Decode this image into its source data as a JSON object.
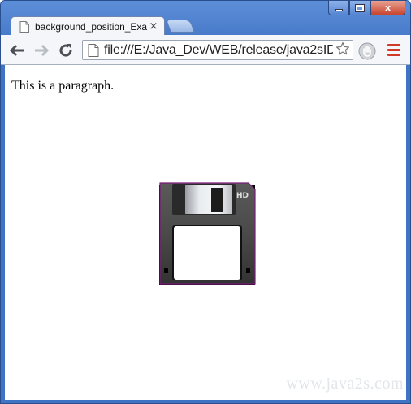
{
  "window": {
    "controls": {
      "minimize_label": "",
      "maximize_label": "",
      "close_label": "x"
    }
  },
  "tab": {
    "title": "background_position_Exa",
    "close_symbol": "×",
    "icon": "page-icon"
  },
  "toolbar": {
    "back_icon": "arrow-left-icon",
    "forward_icon": "arrow-right-icon",
    "reload_icon": "reload-icon",
    "address": "file:///E:/Java_Dev/WEB/release/java2sID",
    "star_icon": "star-icon",
    "extension_icon": "shield-icon",
    "menu_icon": "hamburger-menu-icon",
    "menu_color": "#d13a2a"
  },
  "page": {
    "paragraph": "This is a paragraph.",
    "image": "floppy-disk",
    "watermark": "www.java2s.com"
  }
}
